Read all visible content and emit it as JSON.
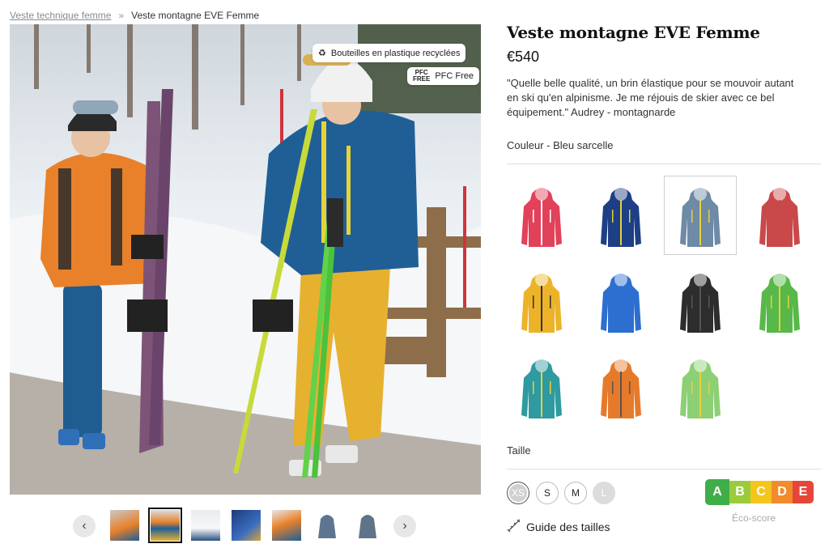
{
  "breadcrumb": {
    "parent": "Veste technique femme",
    "separator": "»",
    "current": "Veste montagne EVE Femme"
  },
  "hero": {
    "badge_bottles": "Bouteilles en plastique recyclées",
    "badge_pfc_mark_top": "PFC",
    "badge_pfc_mark_bottom": "FREE",
    "badge_pfc": "PFC Free"
  },
  "gallery": {
    "prev_icon": "‹",
    "next_icon": "›",
    "thumb_count": 7,
    "active_index": 1
  },
  "product": {
    "title": "Veste montagne EVE Femme",
    "price": "€540",
    "quote": "\"Quelle belle qualité, un brin élastique pour se mouvoir autant en ski qu'en alpinisme. Je me réjouis de skier avec ce bel équipement.\" Audrey - montagnarde",
    "color_label": "Couleur - Bleu sarcelle",
    "colors": [
      {
        "hex": "#e2415a",
        "zip": "#ffffff"
      },
      {
        "hex": "#1d3f86",
        "zip": "#e7d23a"
      },
      {
        "hex": "#6f8aa6",
        "zip": "#e7d23a",
        "selected": true
      },
      {
        "hex": "#c9494a",
        "zip": "#c9494a"
      },
      {
        "hex": "#ecb329",
        "zip": "#333333"
      },
      {
        "hex": "#2c6fd0",
        "zip": "#2c6fd0"
      },
      {
        "hex": "#2d2d2d",
        "zip": "#555555"
      },
      {
        "hex": "#58b84a",
        "zip": "#e7d23a"
      },
      {
        "hex": "#2f9aa0",
        "zip": "#e7d23a"
      },
      {
        "hex": "#e67a2b",
        "zip": "#555555"
      },
      {
        "hex": "#8dcf75",
        "zip": "#e7d23a"
      }
    ],
    "size_label": "Taille",
    "sizes": [
      {
        "label": "XS",
        "state": "selected"
      },
      {
        "label": "S",
        "state": "available"
      },
      {
        "label": "M",
        "state": "available"
      },
      {
        "label": "L",
        "state": "unavailable"
      }
    ],
    "size_guide": "Guide des tailles",
    "eco": {
      "letters": [
        "A",
        "B",
        "C",
        "D",
        "E"
      ],
      "colors": [
        "#3fae49",
        "#9bcb3c",
        "#f3c51d",
        "#f28b2b",
        "#e4473a"
      ],
      "label": "Éco-score"
    }
  }
}
